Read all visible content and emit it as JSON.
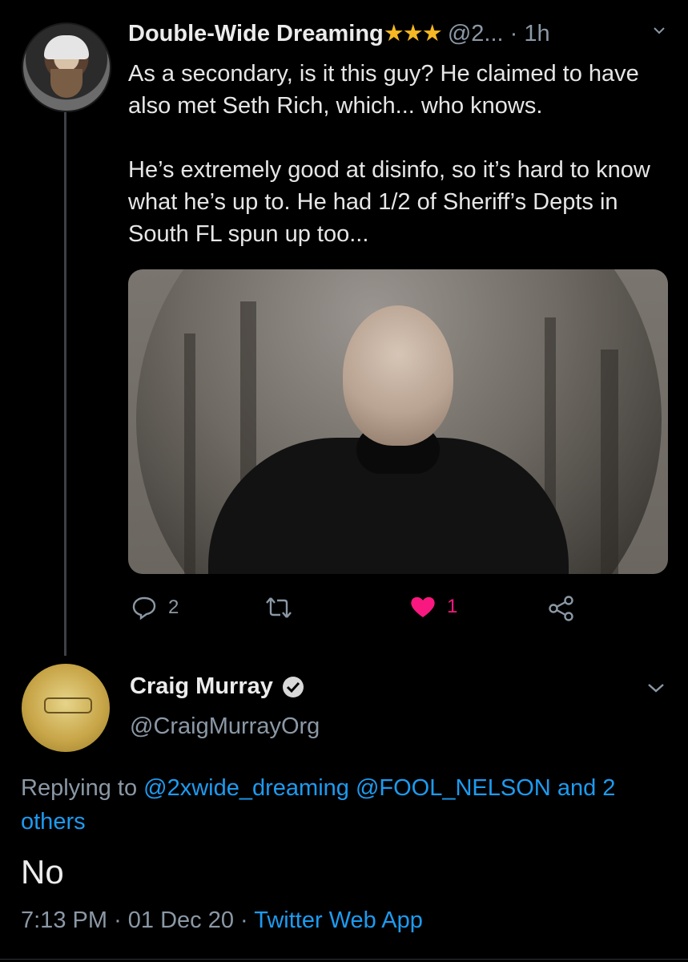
{
  "tweet1": {
    "display_name": "Double-Wide Dreaming",
    "stars": "★★★",
    "handle": "@2...",
    "time": "· 1h",
    "paragraphs": [
      "As a secondary, is it this guy?  He claimed to have also met Seth Rich, which... who knows.",
      "He’s extremely good at disinfo, so it’s hard to know what he’s up to.  He had 1/2 of Sheriff’s Depts in South FL spun up too..."
    ],
    "actions": {
      "reply_count": "2",
      "retweet_count": "",
      "like_count": "1"
    },
    "icons": [
      "reply-icon",
      "retweet-icon",
      "heart-icon",
      "share-icon",
      "chevron-down-icon"
    ]
  },
  "tweet2": {
    "display_name": "Craig Murray",
    "handle": "@CraigMurrayOrg",
    "replying_prefix": "Replying to",
    "replying_to_1": "@2xwide_dreaming",
    "replying_to_2": "@FOOL_NELSON",
    "replying_and": "and",
    "replying_others": "2 others",
    "body": "No",
    "time": "7:13 PM",
    "date": "· 01 Dec 20 ·",
    "source": "Twitter Web App"
  },
  "colors": {
    "background": "#000000",
    "link": "#1d9bf0",
    "like": "#f91880",
    "star": "#f5b823",
    "muted": "#8b98a5"
  }
}
